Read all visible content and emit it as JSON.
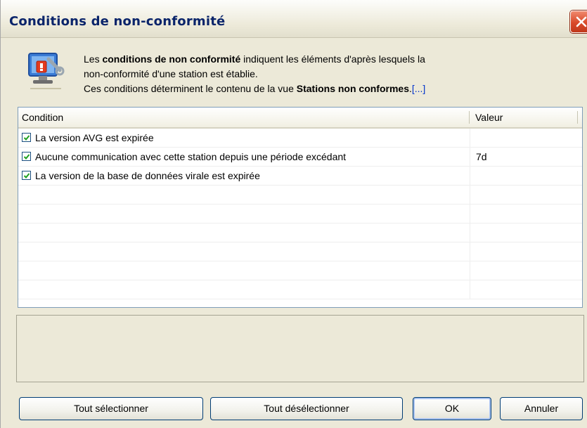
{
  "window": {
    "title": "Conditions de non-conformité"
  },
  "description": {
    "line1_prefix": "Les ",
    "line1_bold": "conditions de non conformité",
    "line1_suffix": " indiquent les éléments d'après lesquels la",
    "line2": "non-conformité d'une station est établie.",
    "line3_prefix": "Ces conditions déterminent le contenu de la vue ",
    "line3_bold": "Stations non conformes",
    "line3_period": ".",
    "line3_link": "[...]"
  },
  "table": {
    "columns": [
      "Condition",
      "Valeur"
    ],
    "rows": [
      {
        "checked": true,
        "condition": "La version AVG est expirée",
        "value": ""
      },
      {
        "checked": true,
        "condition": "Aucune communication avec cette station depuis une période excédant",
        "value": "7d"
      },
      {
        "checked": true,
        "condition": "La version de la base de données virale est expirée",
        "value": ""
      }
    ]
  },
  "buttons": {
    "select_all": "Tout sélectionner",
    "deselect_all": "Tout désélectionner",
    "ok": "OK",
    "cancel": "Annuler"
  },
  "icons": {
    "close": "close-icon",
    "info": "computer-tools-icon",
    "checkbox_checked": "checkmark-icon"
  },
  "colors": {
    "titlebar_text": "#0a246a",
    "close_button": "#d9492a",
    "link": "#0033cc",
    "dialog_bg": "#ece9d8"
  }
}
